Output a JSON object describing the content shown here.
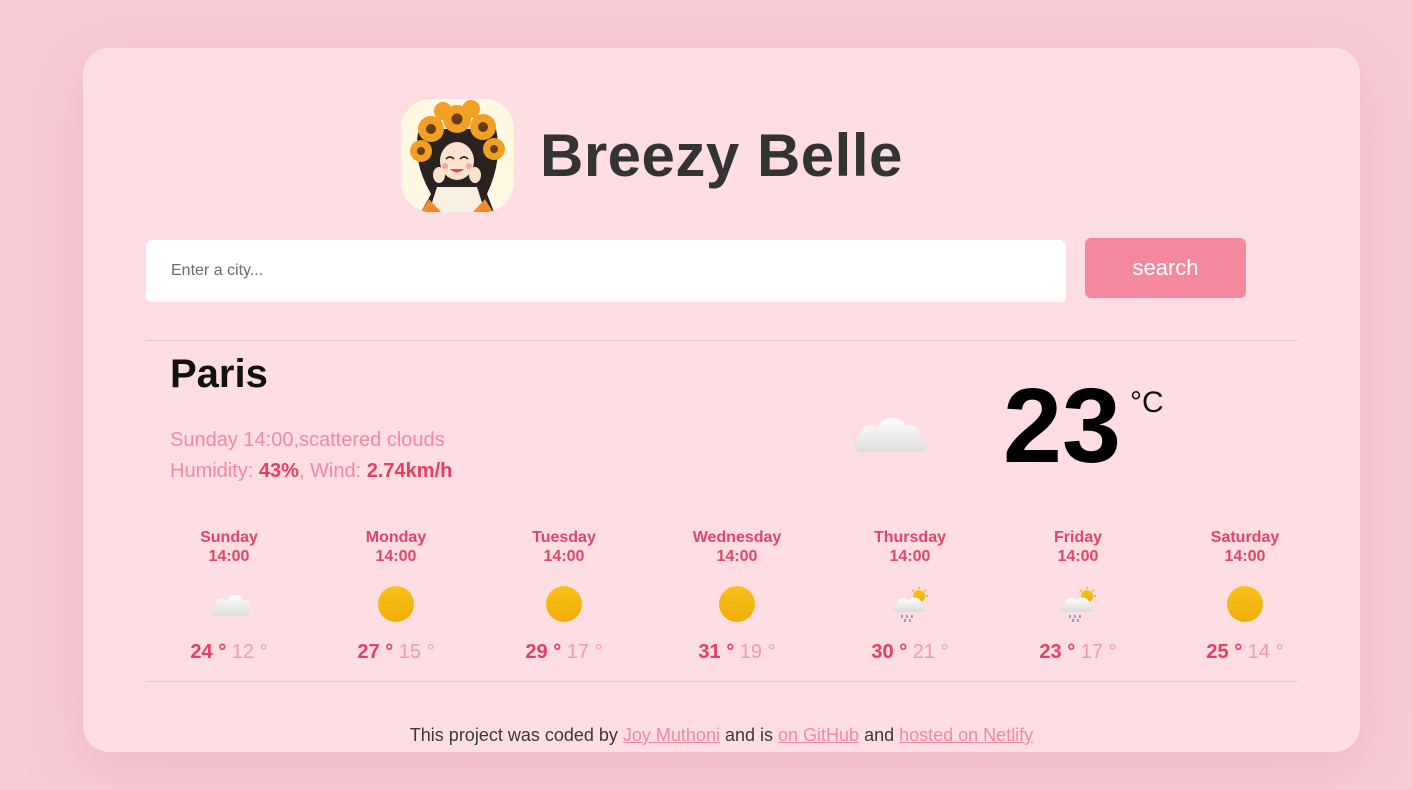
{
  "app": {
    "title": "Breezy Belle"
  },
  "search": {
    "placeholder": "Enter a city...",
    "button_label": "search"
  },
  "current": {
    "city": "Paris",
    "datetime": "Sunday 14:00",
    "separator": ",",
    "description": "scattered clouds",
    "humidity_label": "Humidity: ",
    "humidity": "43%",
    "wind_label": ", Wind: ",
    "wind": "2.74km/h",
    "temperature": "23",
    "unit": "°C",
    "icon": "cloud-icon"
  },
  "forecast": [
    {
      "day": "Sunday",
      "time": "14:00",
      "icon": "cloud-icon",
      "max": "24",
      "min": "12"
    },
    {
      "day": "Monday",
      "time": "14:00",
      "icon": "sun-icon",
      "max": "27",
      "min": "15"
    },
    {
      "day": "Tuesday",
      "time": "14:00",
      "icon": "sun-icon",
      "max": "29",
      "min": "17"
    },
    {
      "day": "Wednesday",
      "time": "14:00",
      "icon": "sun-icon",
      "max": "31",
      "min": "19"
    },
    {
      "day": "Thursday",
      "time": "14:00",
      "icon": "rain-sun-icon",
      "max": "30",
      "min": "21"
    },
    {
      "day": "Friday",
      "time": "14:00",
      "icon": "rain-sun-icon",
      "max": "23",
      "min": "17"
    },
    {
      "day": "Saturday",
      "time": "14:00",
      "icon": "sun-icon",
      "max": "25",
      "min": "14"
    }
  ],
  "degree_symbol": "°",
  "footer": {
    "prefix": "This project was coded by ",
    "author": "Joy Muthoni",
    "middle": " and is ",
    "github": "on GitHub",
    "and": " and ",
    "netlify": "hosted on Netlify"
  },
  "colors": {
    "page_background": "#f8ccd5",
    "card_background": "#fedde3",
    "accent": "#f4899d",
    "accent_dark": "#e63e60",
    "muted_text": "#f18aa0"
  }
}
